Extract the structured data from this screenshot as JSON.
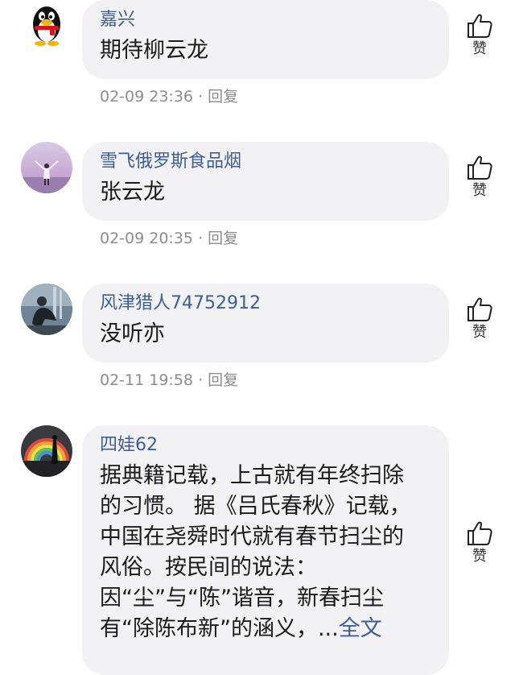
{
  "comments": [
    {
      "username": "嘉兴",
      "lines": [
        "期待柳云龙"
      ],
      "time": "02-09 23:36",
      "separator": "·",
      "reply": "回复",
      "like": "赞"
    },
    {
      "username": "雪飞俄罗斯食品烟",
      "lines": [
        "张云龙"
      ],
      "time": "02-09 20:35",
      "separator": "·",
      "reply": "回复",
      "like": "赞"
    },
    {
      "username": "风津猎人74752912",
      "lines": [
        "没听亦"
      ],
      "time": "02-11 19:58",
      "separator": "·",
      "reply": "回复",
      "like": "赞"
    },
    {
      "username": "四娃62",
      "lines": [
        "据典籍记载，上古就有年终扫除",
        "的习惯。 据《吕氏春秋》记载，",
        "中国在尧舜时代就有春节扫尘的",
        "风俗。按民间的说法：",
        "因“尘”与“陈”谐音，新春扫尘",
        "有“除陈布新”的涵义，..."
      ],
      "full_text_link": "全文",
      "like": "赞"
    }
  ],
  "icons": {
    "like": "thumbs-up-icon"
  },
  "colors": {
    "username": "#3f5e95",
    "bubble": "#f2f2f4",
    "meta": "#8c8c8c"
  }
}
